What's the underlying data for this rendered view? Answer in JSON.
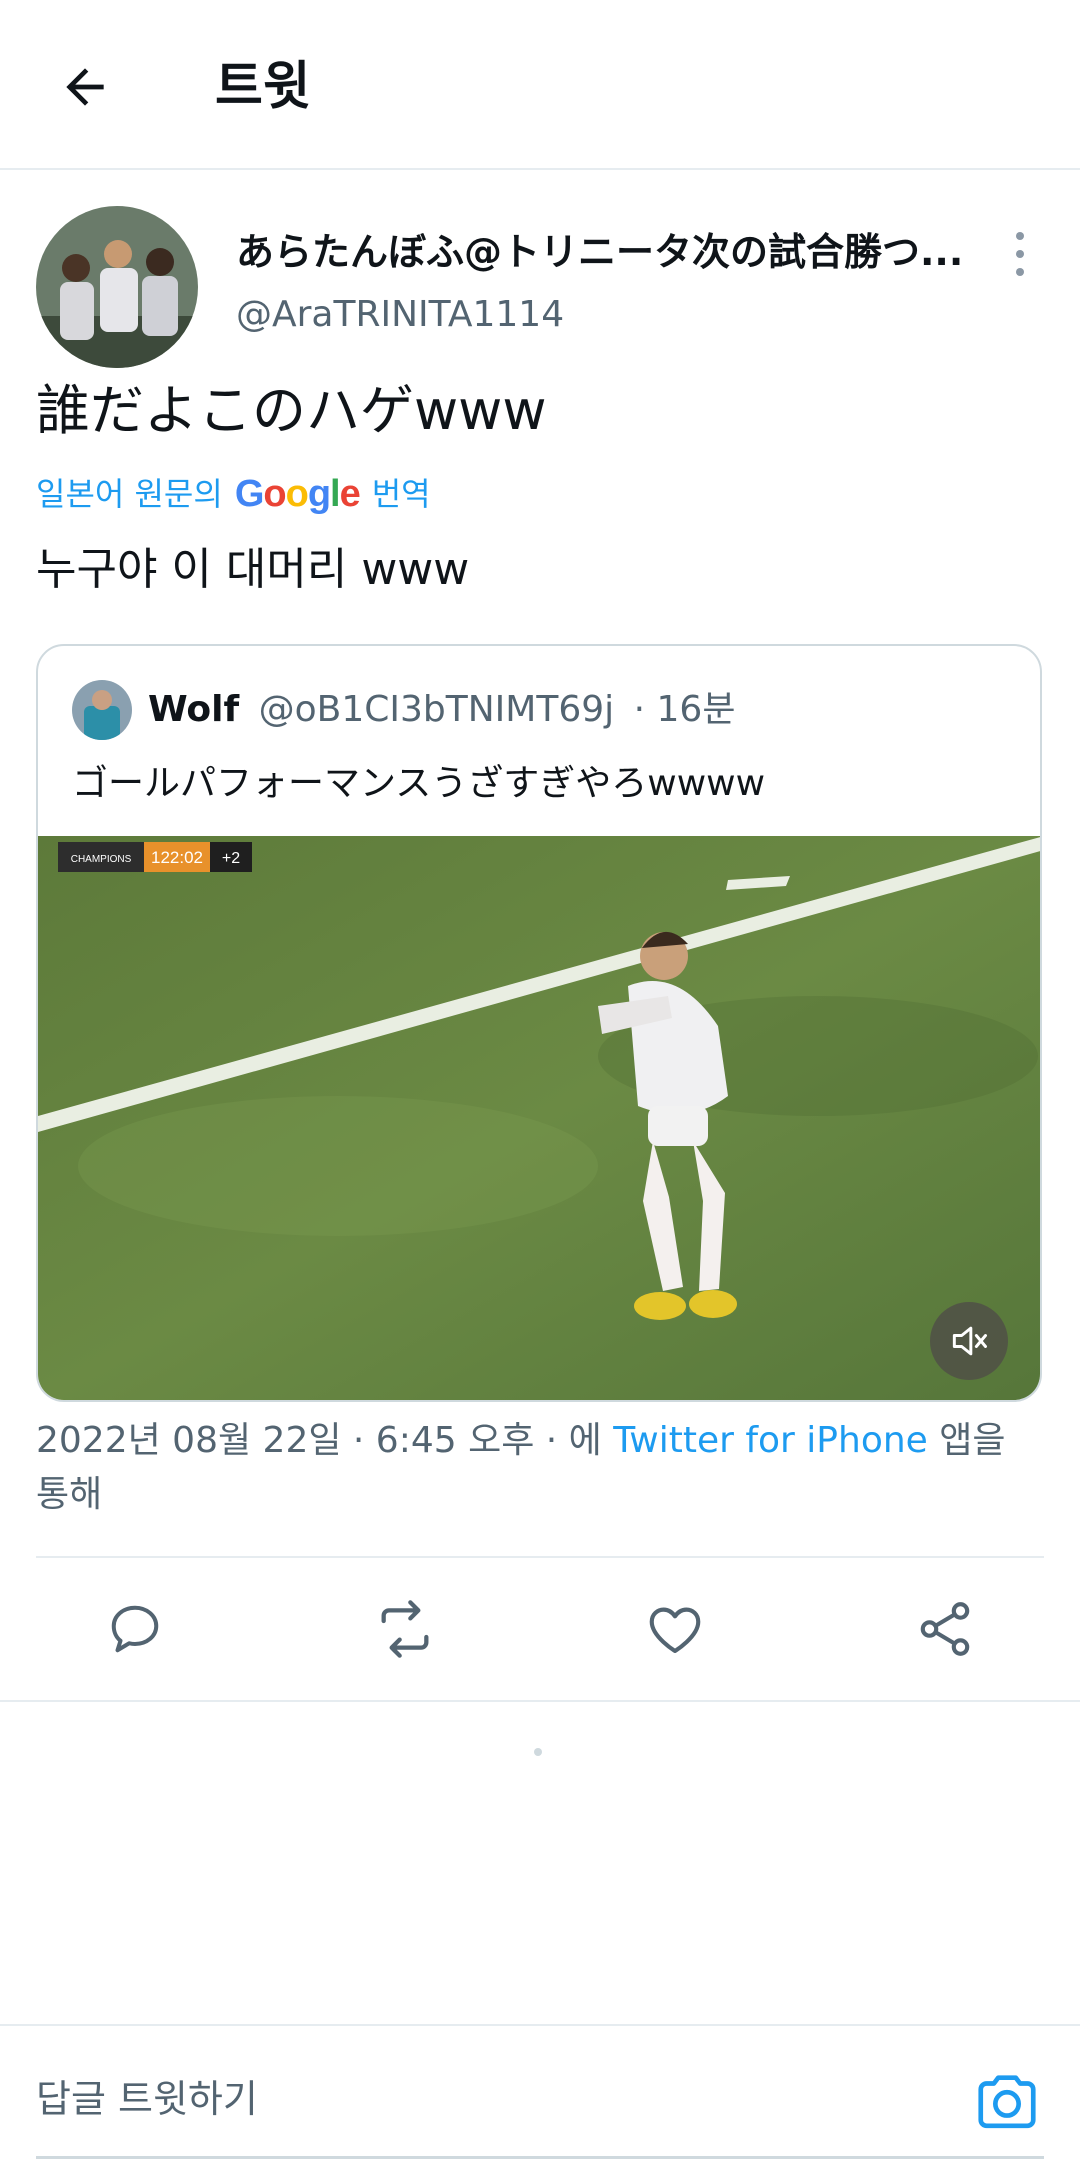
{
  "header": {
    "title": "트윗"
  },
  "tweet": {
    "display_name": "あらたんぼふ@トリニータ次の試合勝つ...",
    "handle": "@AraTRINITA1114",
    "text": "誰だよこのハゲwww",
    "translate": {
      "prefix": "일본어 원문의",
      "brand": "Google",
      "suffix": "번역"
    },
    "translated_text": "누구야 이 대머리 www",
    "timestamp": "2022년 08월 22일 · 6:45 오후 · 에",
    "source_app": "Twitter for iPhone",
    "source_suffix": "앱을 통해"
  },
  "quote": {
    "name": "Wolf",
    "handle": "@oB1CI3bTNIMT69j",
    "time": "· 16분",
    "text": "ゴールパフォーマンスうざすぎやろwwww",
    "scorebug": {
      "league": "CHAMPIONS LEAGUE",
      "clock": "122:02",
      "added": "+2"
    }
  },
  "reply": {
    "placeholder": "답글 트윗하기"
  },
  "icons": [
    "back-arrow-icon",
    "more-icon",
    "mute-icon",
    "reply-icon",
    "retweet-icon",
    "like-icon",
    "share-icon",
    "camera-icon"
  ],
  "colors": {
    "accent": "#1d9bf0",
    "secondary_text": "#536471",
    "border": "#cfd9de"
  }
}
